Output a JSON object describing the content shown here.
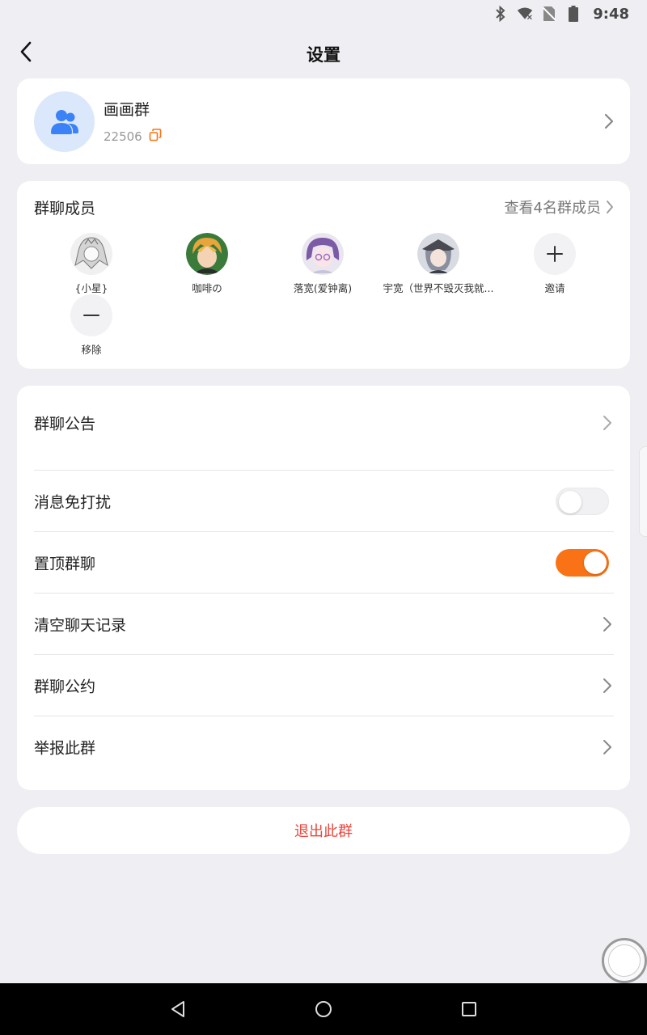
{
  "status_bar": {
    "time": "9:48",
    "icons": [
      "bluetooth-icon",
      "wifi-icon",
      "no-sim-icon",
      "battery-icon"
    ]
  },
  "header": {
    "title": "设置",
    "back_icon": "chevron-left-icon"
  },
  "group": {
    "name": "画画群",
    "id": "22506",
    "avatar_icon": "group-users-icon",
    "copy_icon": "copy-icon"
  },
  "members": {
    "title": "群聊成员",
    "view_all": "查看4名群成员",
    "list": [
      {
        "name": "{小星}"
      },
      {
        "name": "咖啡の"
      },
      {
        "name": "落宽(爱钟离)"
      },
      {
        "name": "宇宽（世界不毁灭我就..."
      }
    ],
    "invite_label": "邀请",
    "remove_label": "移除"
  },
  "settings": {
    "announcement": "群聊公告",
    "mute": "消息免打扰",
    "mute_on": false,
    "pin": "置顶群聊",
    "pin_on": true,
    "clear_history": "清空聊天记录",
    "rules": "群聊公约",
    "report": "举报此群"
  },
  "exit_label": "退出此群",
  "colors": {
    "accent": "#f97316",
    "danger": "#e8453c",
    "avatar_bg": "#dbe8fb",
    "avatar_icon": "#3b82f6",
    "toggle_off": "#f1f1f3"
  }
}
